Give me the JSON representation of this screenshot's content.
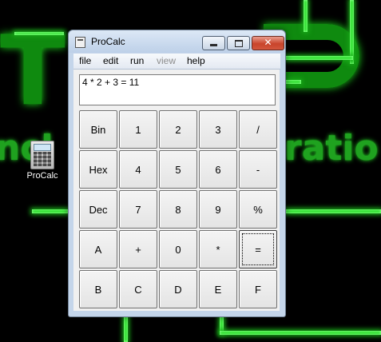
{
  "desktop": {
    "icon_label": "ProCalc"
  },
  "window": {
    "title": "ProCalc",
    "controls": {
      "minimize": "–",
      "maximize": "□",
      "close": "✕"
    }
  },
  "menu": {
    "items": [
      {
        "label": "file",
        "enabled": true
      },
      {
        "label": "edit",
        "enabled": true
      },
      {
        "label": "run",
        "enabled": true
      },
      {
        "label": "view",
        "enabled": false
      },
      {
        "label": "help",
        "enabled": true
      }
    ]
  },
  "display": {
    "text": "4 * 2 + 3 = 11"
  },
  "keypad": {
    "keys": [
      "Bin",
      "1",
      "2",
      "3",
      "/",
      "Hex",
      "4",
      "5",
      "6",
      "-",
      "Dec",
      "7",
      "8",
      "9",
      "%",
      "A",
      "+",
      "0",
      "*",
      "=",
      "B",
      "C",
      "D",
      "E",
      "F"
    ],
    "focused_key": "="
  }
}
